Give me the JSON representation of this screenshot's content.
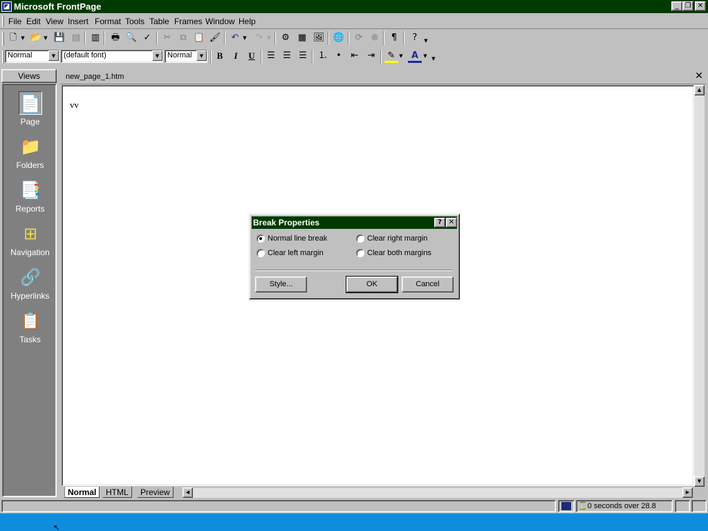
{
  "window": {
    "title": "Microsoft FrontPage"
  },
  "menu": [
    "File",
    "Edit",
    "View",
    "Insert",
    "Format",
    "Tools",
    "Table",
    "Frames",
    "Window",
    "Help"
  ],
  "format_toolbar": {
    "style": "Normal",
    "font": "(default font)",
    "size": "Normal",
    "bold": "B",
    "italic": "I",
    "underline": "U"
  },
  "views": {
    "header": "Views",
    "items": [
      {
        "label": "Page",
        "icon": "page-view-icon"
      },
      {
        "label": "Folders",
        "icon": "folder-icon"
      },
      {
        "label": "Reports",
        "icon": "reports-icon"
      },
      {
        "label": "Navigation",
        "icon": "navigation-icon"
      },
      {
        "label": "Hyperlinks",
        "icon": "hyperlinks-icon"
      },
      {
        "label": "Tasks",
        "icon": "tasks-icon"
      }
    ]
  },
  "document": {
    "filename": "new_page_1.htm",
    "content": "vv",
    "tabs": [
      "Normal",
      "HTML",
      "Preview"
    ],
    "active_tab": "Normal"
  },
  "status": {
    "download_time": "0 seconds over 28.8"
  },
  "dialog": {
    "title": "Break Properties",
    "help": "?",
    "close": "✕",
    "options": [
      {
        "label": "Normal line break",
        "checked": true
      },
      {
        "label": "Clear left margin",
        "checked": false
      },
      {
        "label": "Clear right margin",
        "checked": false
      },
      {
        "label": "Clear both margins",
        "checked": false
      }
    ],
    "buttons": {
      "style": "Style...",
      "ok": "OK",
      "cancel": "Cancel"
    }
  },
  "colors": {
    "titlebar": "#003a00",
    "taskbar": "#0e8ddd",
    "views_bar": "#808080"
  }
}
